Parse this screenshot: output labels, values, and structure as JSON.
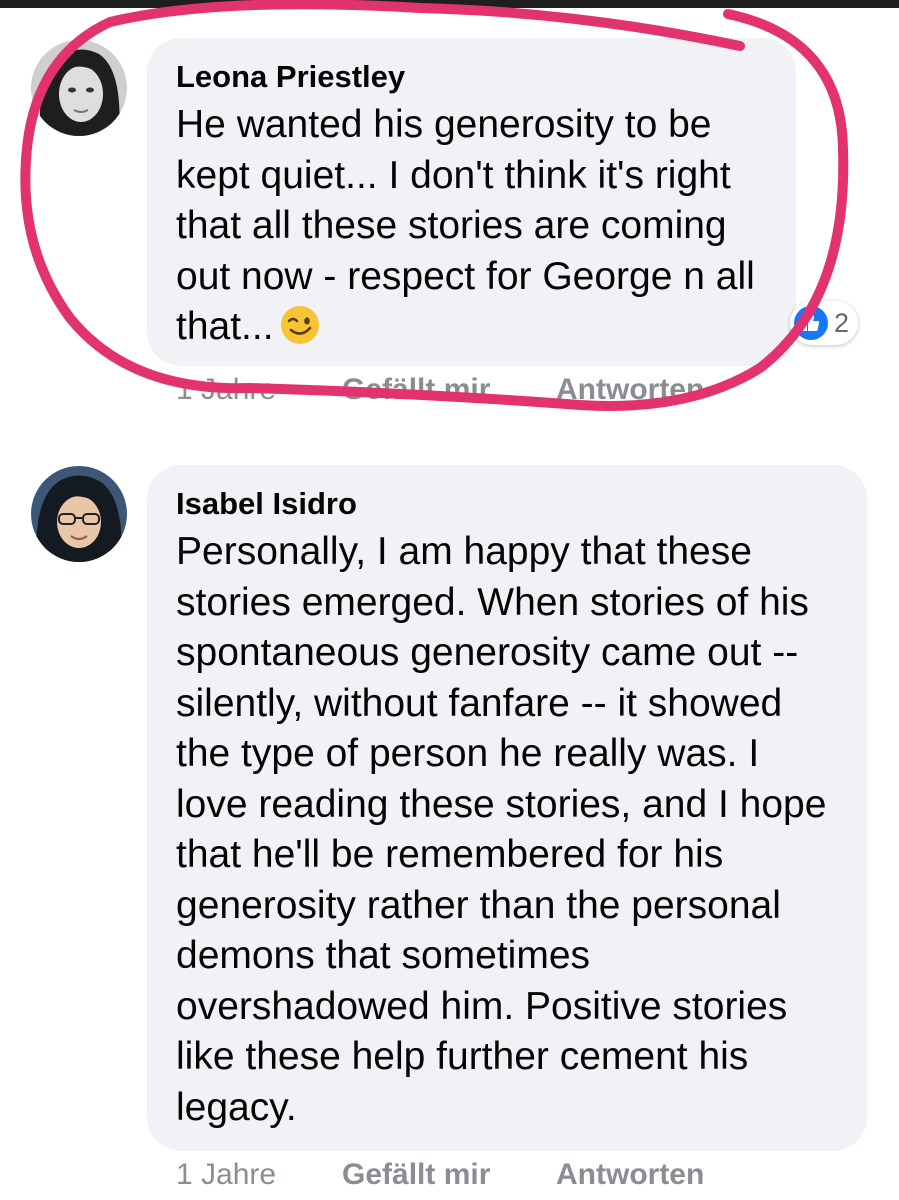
{
  "comments": [
    {
      "author": "Leona Priestley",
      "text": "He wanted his generosity to be\nkept quiet... I don't think it's right\nthat all these stories are coming\nout now - respect for George n all\nthat...",
      "emoji": "winking-face",
      "reaction": {
        "icon": "like-icon",
        "count": "2",
        "color": "#1877f2"
      },
      "time": "1 Jahre",
      "like_label": "Gefällt mir",
      "reply_label": "Antworten"
    },
    {
      "author": "Isabel Isidro",
      "text": "Personally, I am happy that these\nstories emerged.  When stories of his\nspontaneous generosity came out --\nsilently, without fanfare -- it showed\nthe type of person he really was. I\nlove reading these stories, and I hope\nthat he'll be remembered for his\ngenerosity rather than the personal\ndemons that sometimes\novershadowed him. Positive stories\nlike these help further cement his\nlegacy.",
      "time": "1 Jahre",
      "like_label": "Gefällt mir",
      "reply_label": "Antworten"
    }
  ],
  "annotation": {
    "type": "hand-drawn circle",
    "color": "#e2336f"
  },
  "colors": {
    "bubble": "#f0f2f5",
    "meta_text": "#8a8d91",
    "like_blue": "#1877f2"
  }
}
